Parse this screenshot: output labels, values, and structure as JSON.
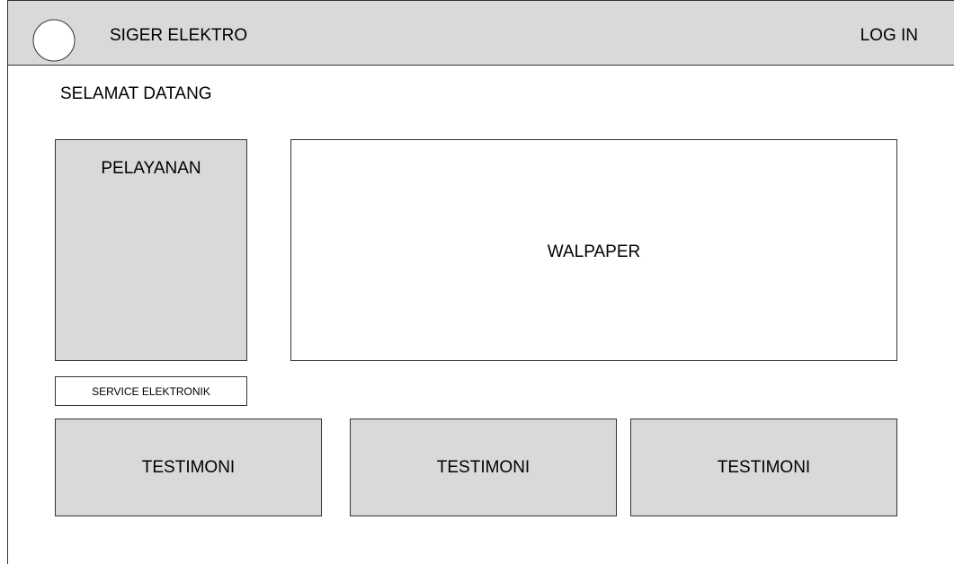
{
  "header": {
    "brand": "SIGER ELEKTRO",
    "login_label": "LOG IN"
  },
  "main": {
    "welcome": "SELAMAT DATANG",
    "services_panel_label": "PELAYANAN",
    "banner_label": "WALPAPER",
    "service_button_label": "SERVICE ELEKTRONIK",
    "testimonials": [
      "TESTIMONI",
      "TESTIMONI",
      "TESTIMONI"
    ]
  },
  "colors": {
    "panel_gray": "#d9d9d9",
    "border": "#333333"
  },
  "icons": {
    "logo": "circle-logo-icon"
  }
}
